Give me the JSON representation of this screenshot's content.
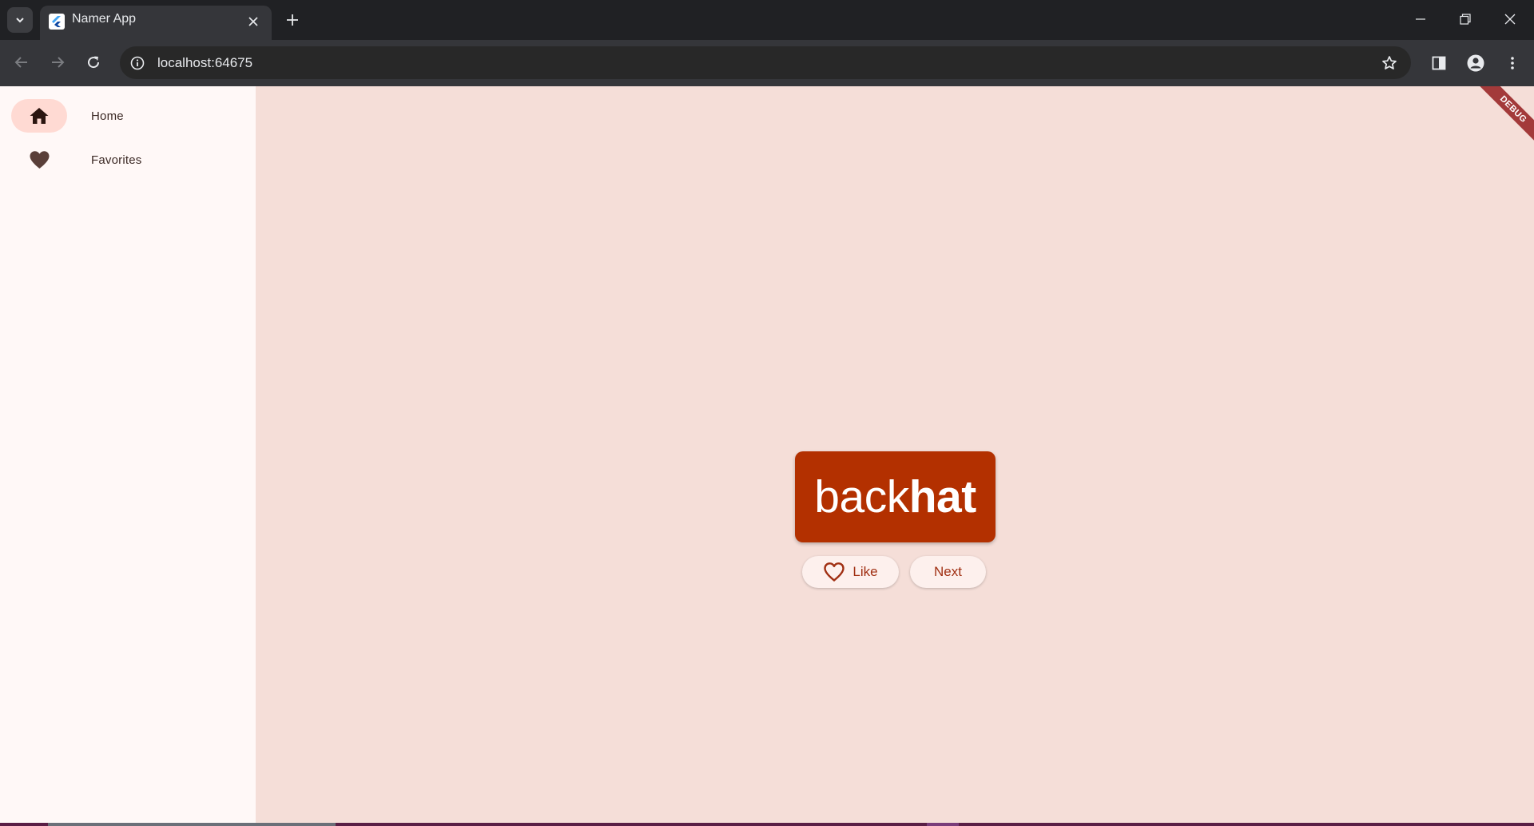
{
  "browser": {
    "tab_title": "Namer App",
    "url": "localhost:64675"
  },
  "icons": {
    "tab_search": "chevron-down-icon",
    "favicon": "flutter-icon",
    "tab_close": "close-icon",
    "new_tab": "plus-icon",
    "back": "back-arrow-icon",
    "forward": "forward-arrow-icon",
    "reload": "reload-icon",
    "site_info": "info-icon",
    "bookmark": "star-icon",
    "side_panel": "side-panel-icon",
    "profile": "profile-icon",
    "menu": "kebab-menu-icon"
  },
  "navigation": {
    "items": [
      {
        "label": "Home",
        "icon": "home-icon",
        "selected": true
      },
      {
        "label": "Favorites",
        "icon": "heart-icon",
        "selected": false
      }
    ]
  },
  "main": {
    "word_first": "back",
    "word_second": "hat",
    "like_label": "Like",
    "next_label": "Next",
    "debug_banner": "DEBUG"
  },
  "colors": {
    "primary": "#b33000",
    "background": "#f5ded8",
    "rail_background": "#fff8f7",
    "selected_indicator": "#ffdad3"
  }
}
